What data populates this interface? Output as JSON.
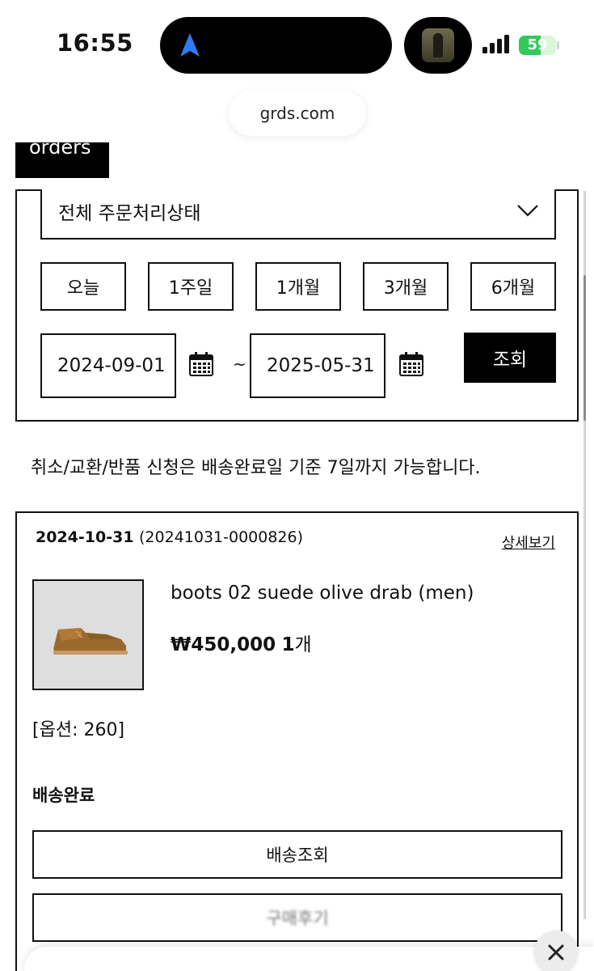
{
  "status_bar": {
    "time": "16:55",
    "battery": "59",
    "battery_level": 0.59
  },
  "browser": {
    "url": "grds.com"
  },
  "page": {
    "tab_label": "orders"
  },
  "filter": {
    "status_select": "전체 주문처리상태",
    "periods": [
      "오늘",
      "1주일",
      "1개월",
      "3개월",
      "6개월"
    ],
    "date_from": "2024-09-01",
    "date_to": "2025-05-31",
    "range_separator": "~",
    "search_label": "조회"
  },
  "notice": "취소/교환/반품 신청은 배송완료일 기준 7일까지 가능합니다.",
  "order": {
    "date": "2024-10-31",
    "number": "(20241031-0000826)",
    "detail_link": "상세보기",
    "product_name": "boots 02 suede olive drab (men)",
    "price": "₩450,000",
    "quantity": "1",
    "quantity_unit": "개",
    "option": "[옵션: 260]",
    "shipping_status": "배송완료",
    "track_button": "배송조회",
    "review_button": "구매후기"
  },
  "colors": {
    "primary": "#000000",
    "battery_green": "#34c759"
  },
  "icons": [
    "location-arrow-icon",
    "calendar-icon",
    "chevron-down-icon",
    "close-icon",
    "signal-icon",
    "battery-icon"
  ]
}
